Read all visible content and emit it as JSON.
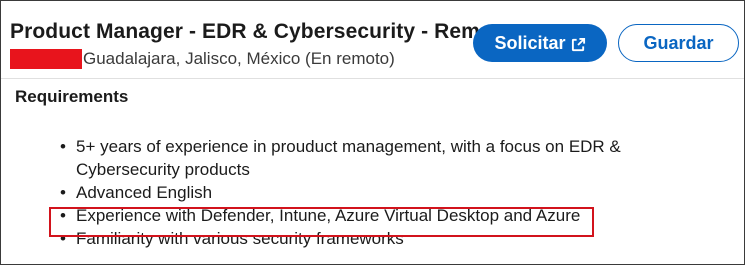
{
  "header": {
    "title": "Product Manager - EDR & Cybersecurity - Rem…",
    "location": "Guadalajara, Jalisco, México (En remoto)"
  },
  "actions": {
    "apply_label": "Solicitar",
    "save_label": "Guardar"
  },
  "requirements": {
    "heading": "Requirements",
    "items": [
      "5+ years of experience in prouduct management, with a focus on EDR & Cybersecurity products",
      "Advanced English",
      "Experience with Defender, Intune, Azure Virtual Desktop and Azure",
      "Familiarity with various security frameworks"
    ],
    "bullet": "•"
  },
  "colors": {
    "accent": "#0a66c2",
    "highlight_box": "#d2131c",
    "redaction": "#e8141c"
  },
  "icons": {
    "apply_icon": "external-link-icon"
  }
}
